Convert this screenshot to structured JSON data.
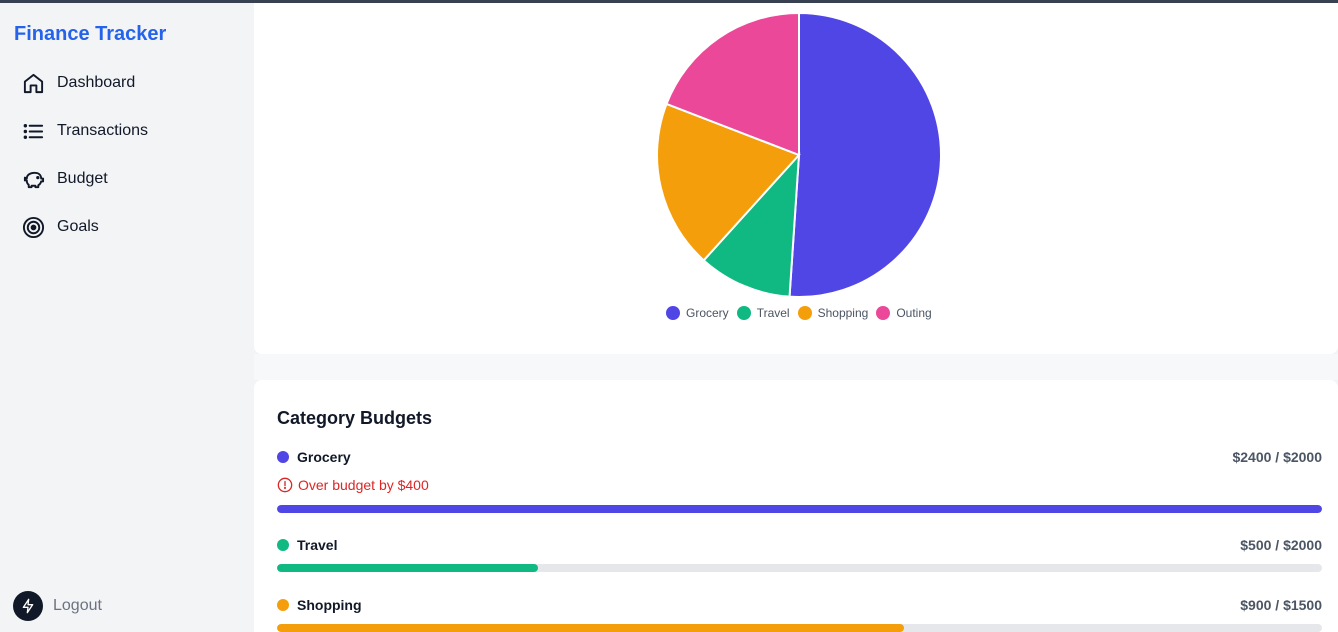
{
  "app": {
    "title": "Finance Tracker"
  },
  "sidebar": {
    "items": [
      {
        "label": "Dashboard",
        "icon": "home-icon"
      },
      {
        "label": "Transactions",
        "icon": "list-icon"
      },
      {
        "label": "Budget",
        "icon": "piggy-bank-icon"
      },
      {
        "label": "Goals",
        "icon": "target-icon"
      }
    ],
    "logout_label": "Logout"
  },
  "chart_data": {
    "type": "pie",
    "categories": [
      "Grocery",
      "Travel",
      "Shopping",
      "Outing"
    ],
    "values": [
      2400,
      500,
      900,
      900
    ],
    "colors": [
      "#4f46e5",
      "#10b981",
      "#f59e0b",
      "#ec4899"
    ],
    "legend_position": "bottom"
  },
  "budgets": {
    "title": "Category Budgets",
    "items": [
      {
        "name": "Grocery",
        "amount_text": "$2400 / $2000",
        "spent": 2400,
        "limit": 2000,
        "color": "#4f46e5",
        "warning": "Over budget by $400"
      },
      {
        "name": "Travel",
        "amount_text": "$500 / $2000",
        "spent": 500,
        "limit": 2000,
        "color": "#10b981"
      },
      {
        "name": "Shopping",
        "amount_text": "$900 / $1500",
        "spent": 900,
        "limit": 1500,
        "color": "#f59e0b"
      }
    ]
  }
}
